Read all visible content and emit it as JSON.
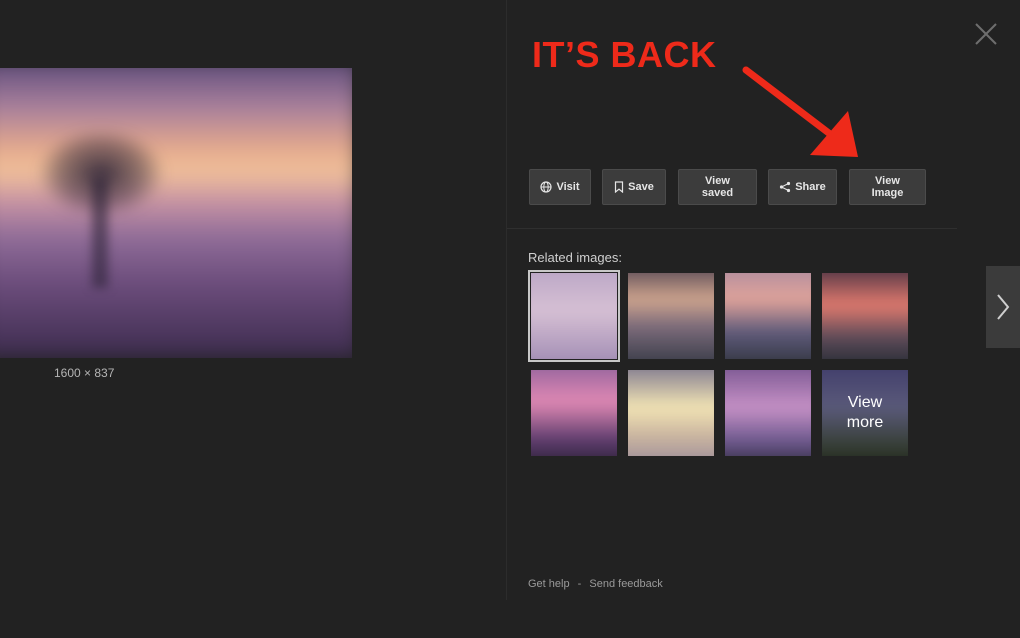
{
  "preview": {
    "dimensions": "1600 × 837"
  },
  "annotation": {
    "text": "IT’S BACK",
    "color": "#ee2a1a"
  },
  "actions": {
    "visit": "Visit",
    "save": "Save",
    "view_saved": "View\nsaved",
    "share": "Share",
    "view_image": "View\nImage"
  },
  "related": {
    "title": "Related images:",
    "view_more": "View\nmore"
  },
  "footer": {
    "get_help": "Get help",
    "separator": "-",
    "send_feedback": "Send feedback"
  },
  "icons": {
    "close": "close-icon",
    "next": "chevron-right-icon",
    "visit": "globe-icon",
    "save": "bookmark-icon",
    "share": "share-icon"
  }
}
